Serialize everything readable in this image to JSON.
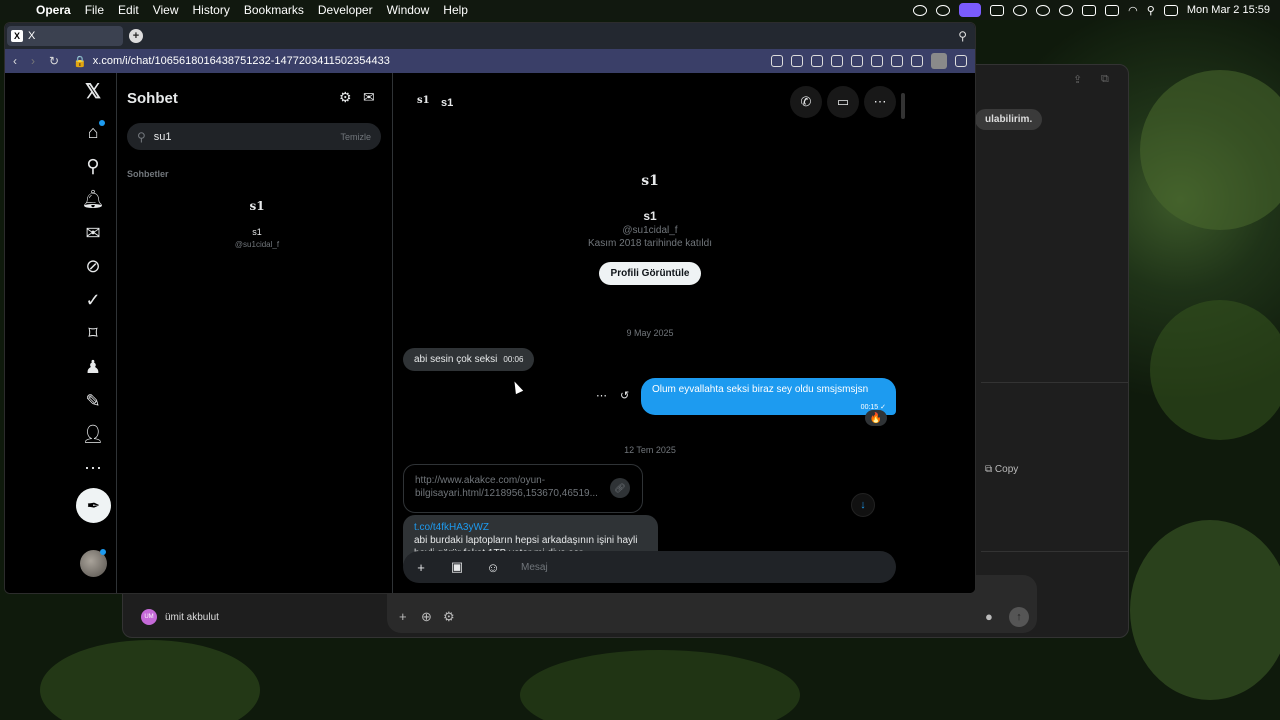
{
  "menubar": {
    "app": "Opera",
    "items": [
      "File",
      "Edit",
      "View",
      "History",
      "Bookmarks",
      "Developer",
      "Window",
      "Help"
    ],
    "clock": "Mon Mar 2  15:59"
  },
  "background_window": {
    "bubble_text": "ulabilirim.",
    "copy_label": "Copy",
    "user_initials": "UM",
    "user_name": "ümit akbulut"
  },
  "browser": {
    "tab_title": "X",
    "url": "x.com/i/chat/1065618016438751232-1477203411502354433"
  },
  "x": {
    "sidebar": {
      "title": "Sohbet",
      "search_value": "su1",
      "clear_label": "Temizle",
      "section_label": "Sohbetler",
      "result": {
        "logo": "s1",
        "name": "s1",
        "handle": "@su1cidal_f"
      }
    },
    "conversation": {
      "header_logo": "s1",
      "header_name": "s1",
      "profile": {
        "logo": "s1",
        "name": "s1",
        "handle": "@su1cidal_f",
        "joined": "Kasım 2018 tarihinde katıldı",
        "view_profile_label": "Profili Görüntüle"
      },
      "date1": "9 May 2025",
      "msg_in1": {
        "text": "abi sesin çok seksi",
        "time": "00:06"
      },
      "msg_out1": {
        "text": "Olum eyvallahta seksi biraz sey oldu smsjsmsjsn",
        "time": "00:15 ✓",
        "reaction": "🔥"
      },
      "date2": "12 Tem 2025",
      "link_card": {
        "line1": "http://www.akakce.com/oyun-",
        "line2": "bilgisayari.html/1218956,153670,46519..."
      },
      "msg_link": {
        "url": "t.co/t4fkHA3yWZ",
        "line1": "abi burdaki laptopların hepsi arkadaşının işini hayli",
        "line2": "hayli görür fakat 1TB yeter mi diye sor"
      },
      "composer_placeholder": "Mesaj"
    }
  }
}
